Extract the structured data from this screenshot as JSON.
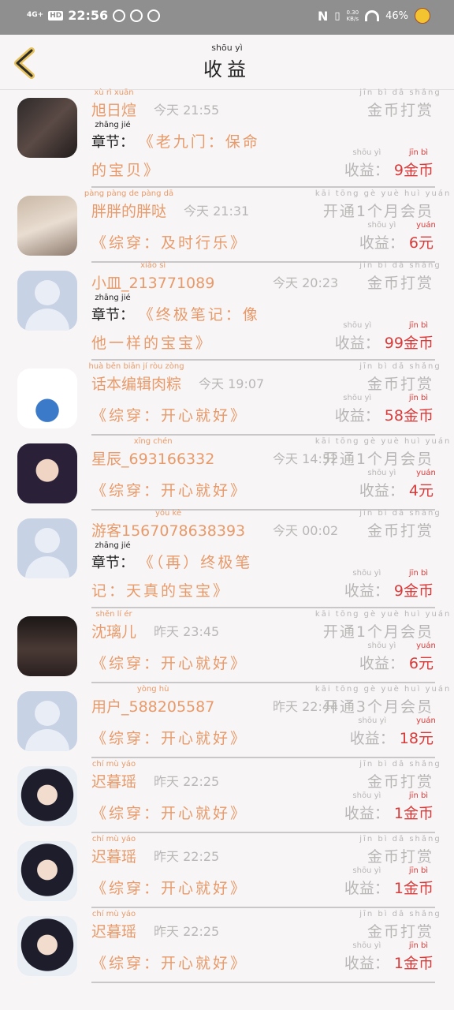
{
  "status_bar": {
    "network": "4G+",
    "hd": "HD",
    "time": "22:56",
    "nfc": "N",
    "speed_value": "0.30",
    "speed_unit": "KB/s",
    "battery": "46%"
  },
  "header": {
    "title": "收益",
    "title_pinyin": "shōu yì"
  },
  "labels": {
    "chapter_label": "章节：",
    "chapter_pinyin": "zhāng jié",
    "income_label": "收益：",
    "income_pinyin": "shōu yì",
    "coin": "金币",
    "coin_pinyin": "jīn bì",
    "yuan": "元",
    "yuan_pinyin": "yuán",
    "reward": "金币打赏",
    "reward_pinyin": "jīn bì dǎ shǎng"
  },
  "rows": [
    {
      "name": "旭日煊",
      "name_pinyin": "xù rì xuān",
      "time": "今天 21:55",
      "type": "金币打赏",
      "type_pinyin": "jīn bì dǎ shǎng",
      "chapter": "《老九门：保命的宝贝》",
      "chapter_line2": "的宝贝》",
      "chapter_line1": "《老九门：保命",
      "amount": "9",
      "unit": "金币"
    },
    {
      "name": "胖胖的胖哒",
      "name_pinyin": "pàng pàng de pàng dā",
      "time": "今天 21:31",
      "type": "开通1个月会员",
      "type_pinyin": "kāi tōng gè yuè huì yuán",
      "book": "《综穿：及时行乐》",
      "amount": "6",
      "unit": "元"
    },
    {
      "name": "小皿_213771089",
      "name_pinyin": "xiǎo sì",
      "time": "今天 20:23",
      "type": "金币打赏",
      "type_pinyin": "jīn bì dǎ shǎng",
      "chapter_line1": "《终极笔记：像",
      "chapter_line2": "他一样的宝宝》",
      "amount": "99",
      "unit": "金币"
    },
    {
      "name": "话本编辑肉粽",
      "name_pinyin": "huà běn biān jí ròu zòng",
      "time": "今天 19:07",
      "type": "金币打赏",
      "type_pinyin": "jīn bì dǎ shǎng",
      "book": "《综穿：开心就好》",
      "amount": "58",
      "unit": "金币"
    },
    {
      "name": "星辰_693166332",
      "name_pinyin": "xīng chén",
      "time": "今天 14:52",
      "type": "开通1个月会员",
      "type_pinyin": "kāi tōng gè yuè huì yuán",
      "book": "《综穿：开心就好》",
      "amount": "4",
      "unit": "元"
    },
    {
      "name": "游客1567078638393",
      "name_pinyin": "yóu kè",
      "time": "今天 00:02",
      "type": "金币打赏",
      "type_pinyin": "jīn bì dǎ shǎng",
      "chapter_line1": "《（再）终极笔",
      "chapter_line2": "记：天真的宝宝》",
      "amount": "9",
      "unit": "金币"
    },
    {
      "name": "沈璃儿",
      "name_pinyin": "shěn lí ér",
      "time": "昨天 23:45",
      "type": "开通1个月会员",
      "type_pinyin": "kāi tōng gè yuè huì yuán",
      "book": "《综穿：开心就好》",
      "amount": "6",
      "unit": "元"
    },
    {
      "name": "用户_588205587",
      "name_pinyin": "yòng hù",
      "time": "昨天 22:44",
      "type": "开通3个月会员",
      "type_pinyin": "kāi tōng gè yuè huì yuán",
      "book": "《综穿：开心就好》",
      "amount": "18",
      "unit": "元"
    },
    {
      "name": "迟暮瑶",
      "name_pinyin": "chí mù yáo",
      "time": "昨天 22:25",
      "type": "金币打赏",
      "type_pinyin": "jīn bì dǎ shǎng",
      "book": "《综穿：开心就好》",
      "amount": "1",
      "unit": "金币"
    },
    {
      "name": "迟暮瑶",
      "name_pinyin": "chí mù yáo",
      "time": "昨天 22:25",
      "type": "金币打赏",
      "type_pinyin": "jīn bì dǎ shǎng",
      "book": "《综穿：开心就好》",
      "amount": "1",
      "unit": "金币"
    },
    {
      "name": "迟暮瑶",
      "name_pinyin": "chí mù yáo",
      "time": "昨天 22:25",
      "type": "金币打赏",
      "type_pinyin": "jīn bì dǎ shǎng",
      "book": "《综穿：开心就好》",
      "amount": "1",
      "unit": "金币"
    }
  ]
}
